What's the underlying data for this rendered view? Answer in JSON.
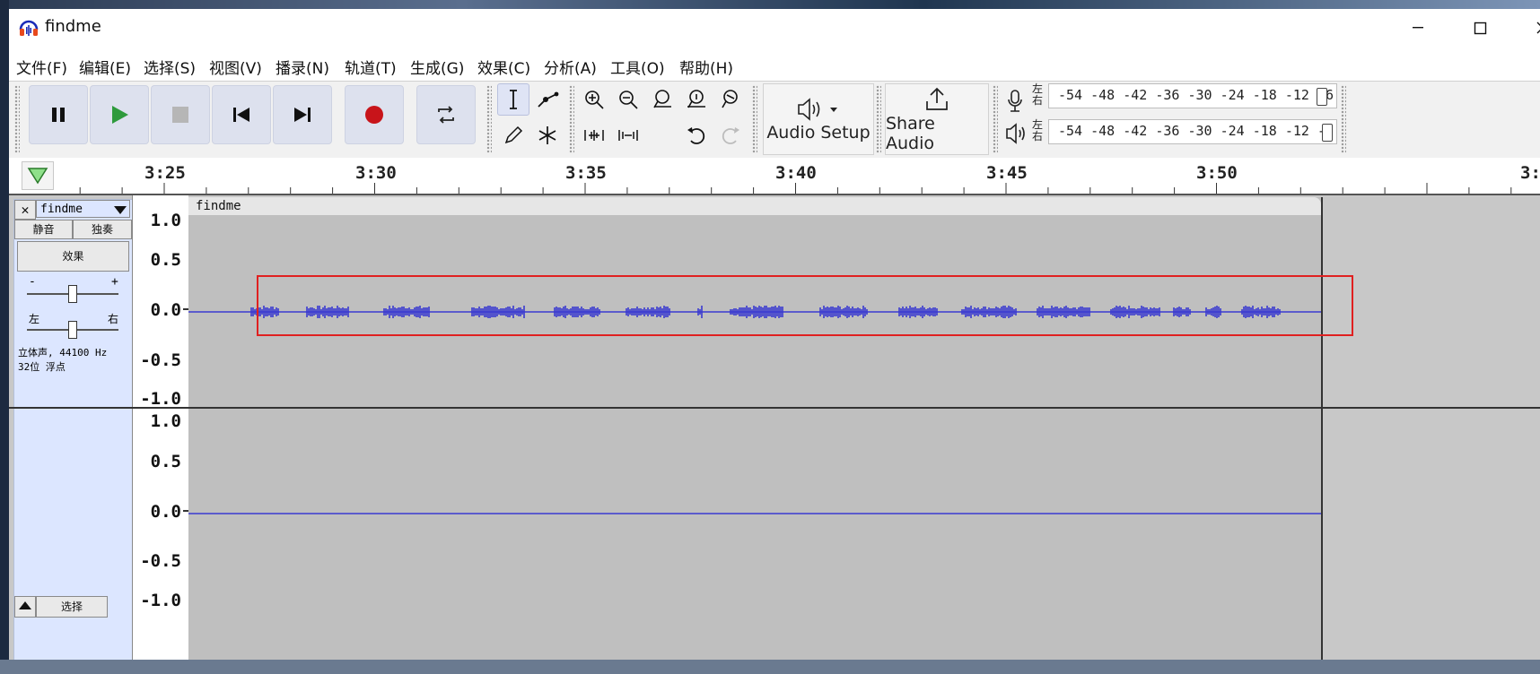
{
  "window": {
    "title": "findme"
  },
  "menu": [
    "文件(F)",
    "编辑(E)",
    "选择(S)",
    "视图(V)",
    "播录(N)",
    "轨道(T)",
    "生成(G)",
    "效果(C)",
    "分析(A)",
    "工具(O)",
    "帮助(H)"
  ],
  "toolbar": {
    "audio_setup_label": "Audio Setup",
    "share_audio_label": "Share Audio",
    "meter": {
      "left_label": "左",
      "right_label": "右",
      "ticks": "-54 -48 -42 -36 -30 -24 -18 -12  -6"
    }
  },
  "ruler": {
    "labels": [
      "3:25",
      "3:30",
      "3:35",
      "3:40",
      "3:45",
      "3:50",
      "3:"
    ]
  },
  "track": {
    "name": "findme",
    "mute_label": "静音",
    "solo_label": "独奏",
    "effects_label": "效果",
    "gain_minus": "-",
    "gain_plus": "+",
    "pan_left": "左",
    "pan_right": "右",
    "info_line1": "立体声, 44100 Hz",
    "info_line2": "32位 浮点",
    "select_label": "选择",
    "clip_name": "findme"
  },
  "scale": {
    "upper": [
      "1.0",
      "0.5",
      "0.0",
      "-0.5",
      "-1.0"
    ],
    "lower": [
      "1.0",
      "0.5",
      "0.0",
      "-0.5",
      "-1.0"
    ]
  },
  "colors": {
    "waveform": "#3a3ad0",
    "highlight": "#e02020",
    "track_panel": "#dce6ff",
    "clip_bg": "#bfbfbf"
  }
}
